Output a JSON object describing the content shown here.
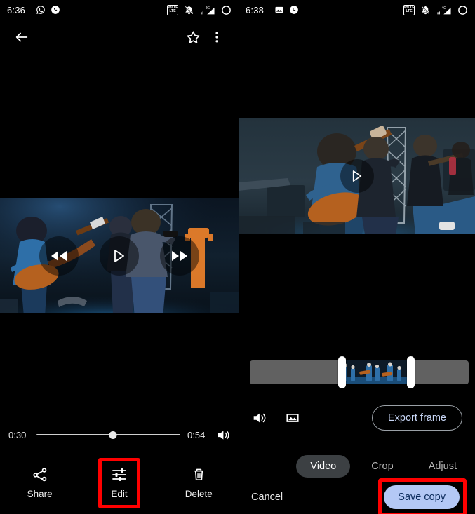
{
  "left_panel": {
    "status_bar": {
      "time": "6:36",
      "left_icons": [
        "whatsapp-icon",
        "phone-call-icon"
      ],
      "right_icons": [
        "volte-icon",
        "notifications-muted-icon",
        "signal-4g-icon",
        "battery-icon"
      ],
      "volte_label_top": "VoLTE",
      "volte_label_bottom": "LTE",
      "network_label": "4G"
    },
    "app_bar": {
      "back_icon": "back-arrow-icon",
      "favorite_icon": "star-outline-icon",
      "overflow_icon": "more-vertical-icon"
    },
    "video": {
      "rewind_icon": "rewind-icon",
      "play_icon": "play-icon",
      "forward_icon": "fast-forward-icon"
    },
    "player": {
      "current_time": "0:30",
      "total_time": "0:54",
      "progress_percent": 53,
      "volume_icon": "volume-up-icon"
    },
    "actions": [
      {
        "label": "Share",
        "icon": "share-icon",
        "highlighted": false
      },
      {
        "label": "Edit",
        "icon": "tune-sliders-icon",
        "highlighted": true
      },
      {
        "label": "Delete",
        "icon": "trash-icon",
        "highlighted": false
      }
    ]
  },
  "right_panel": {
    "status_bar": {
      "time": "6:38",
      "left_icons": [
        "image-icon",
        "phone-call-icon"
      ],
      "right_icons": [
        "volte-icon",
        "notifications-muted-icon",
        "signal-4g-icon",
        "battery-icon"
      ],
      "volte_label_top": "VoLTE",
      "volte_label_bottom": "LTE",
      "network_label": "4G"
    },
    "preview": {
      "play_icon": "play-icon"
    },
    "trim": {
      "left_handle": "trim-start-handle",
      "right_handle": "trim-end-handle",
      "selection_start_percent": 42,
      "selection_end_percent": 73,
      "annotation": "red-arrow-annotation"
    },
    "tool_row": {
      "volume_icon": "volume-up-icon",
      "stabilize_icon": "stabilize-icon",
      "export_frame_label": "Export frame"
    },
    "tabs": [
      {
        "label": "Video",
        "selected": true
      },
      {
        "label": "Crop",
        "selected": false
      },
      {
        "label": "Adjust",
        "selected": false
      }
    ],
    "bottom": {
      "cancel_label": "Cancel",
      "save_label": "Save copy",
      "save_highlighted": true
    }
  },
  "colors": {
    "highlight": "#ff0000",
    "save_button_bg": "#b4c8f5",
    "save_button_text": "#0b2a5b",
    "tab_selected_bg": "#3c4043",
    "trim_track": "#616161",
    "background": "#000000"
  }
}
